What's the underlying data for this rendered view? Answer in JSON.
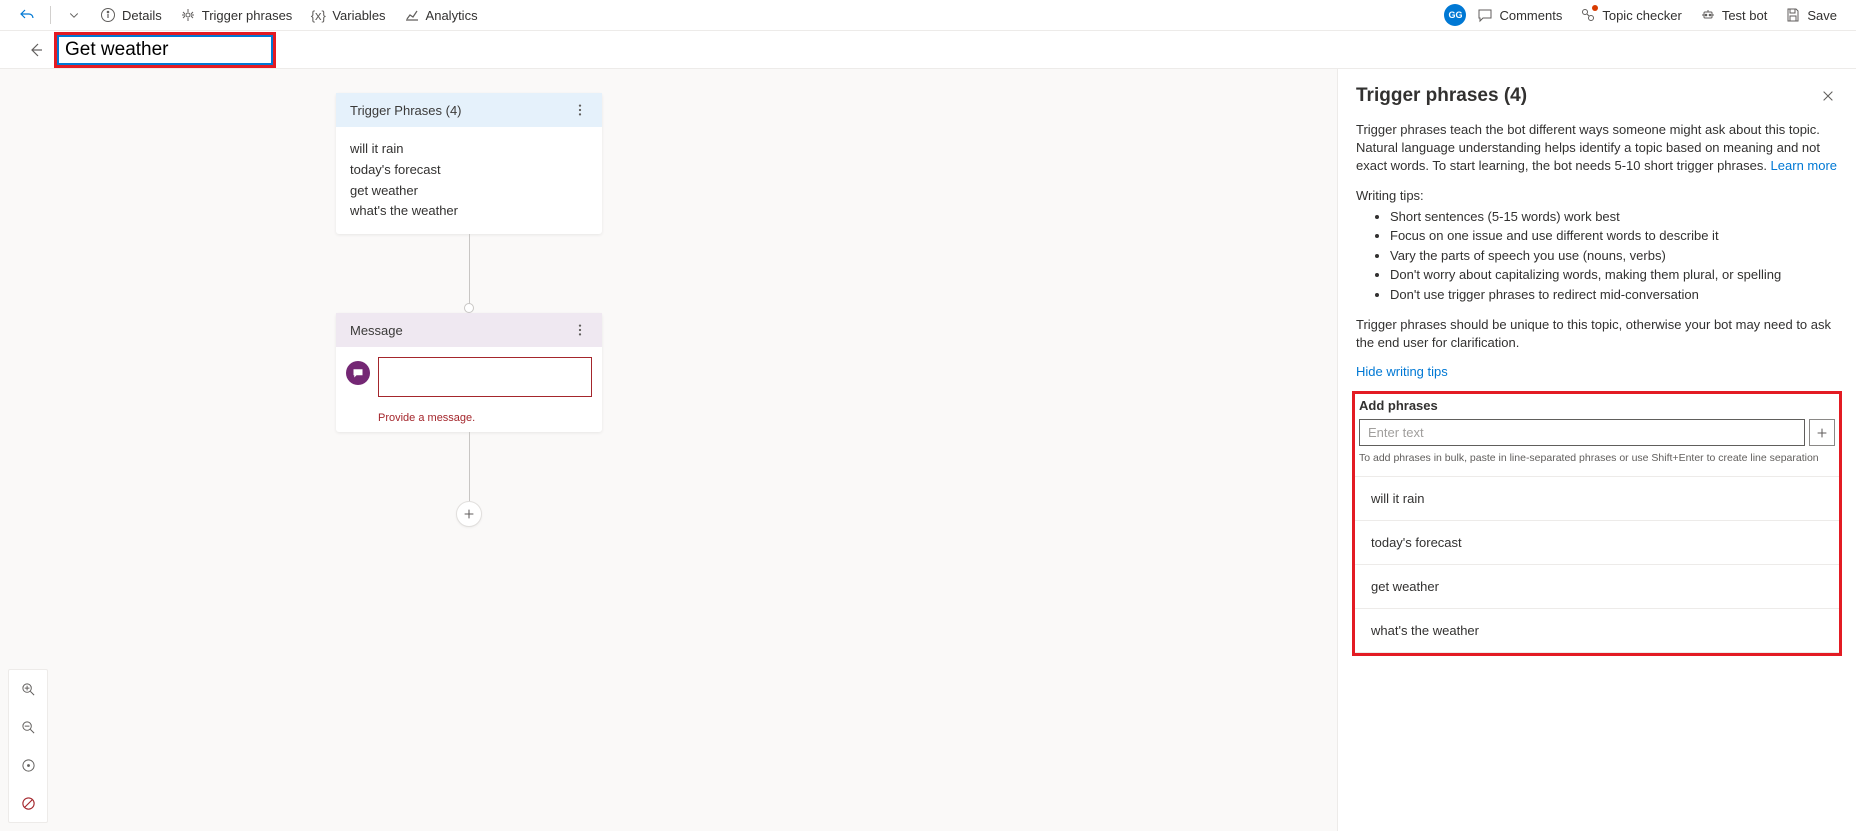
{
  "toolbar": {
    "details": "Details",
    "trigger_phrases": "Trigger phrases",
    "variables": "Variables",
    "analytics": "Analytics",
    "avatar_initials": "GG",
    "comments": "Comments",
    "topic_checker": "Topic checker",
    "test_bot": "Test bot",
    "save": "Save"
  },
  "title_value": "Get weather",
  "trigger_node": {
    "header": "Trigger Phrases (4)",
    "phrases": [
      "will it rain",
      "today's forecast",
      "get weather",
      "what's the weather"
    ]
  },
  "message_node": {
    "header": "Message",
    "error": "Provide a message."
  },
  "panel": {
    "title": "Trigger phrases (4)",
    "description_1": "Trigger phrases teach the bot different ways someone might ask about this topic. Natural language understanding helps identify a topic based on meaning and not exact words. To start learning, the bot needs 5-10 short trigger phrases. ",
    "learn_more": "Learn more",
    "tips_title": "Writing tips:",
    "tips": [
      "Short sentences (5-15 words) work best",
      "Focus on one issue and use different words to describe it",
      "Vary the parts of speech you use (nouns, verbs)",
      "Don't worry about capitalizing words, making them plural, or spelling",
      "Don't use trigger phrases to redirect mid-conversation"
    ],
    "description_2": "Trigger phrases should be unique to this topic, otherwise your bot may need to ask the end user for clarification.",
    "hide_tips": "Hide writing tips",
    "add_label": "Add phrases",
    "add_placeholder": "Enter text",
    "add_hint": "To add phrases in bulk, paste in line-separated phrases or use Shift+Enter to create line separation",
    "phrases": [
      "will it rain",
      "today's forecast",
      "get weather",
      "what's the weather"
    ]
  }
}
